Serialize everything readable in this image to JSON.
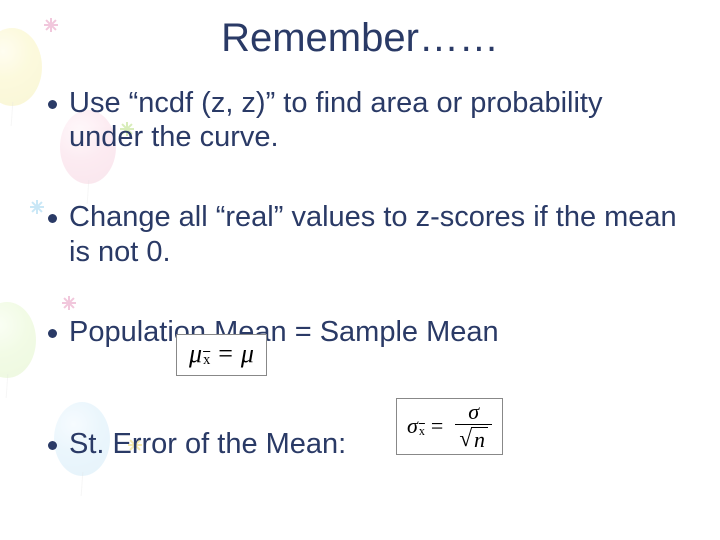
{
  "slide": {
    "title": "Remember……",
    "bullets": [
      "Use “ncdf (z, z)” to find area or probability under the curve.",
      "Change all “real” values to z-scores if the mean is not 0.",
      "Population Mean = Sample Mean",
      "St. Error of the Mean:"
    ],
    "formulas": {
      "population_mean": {
        "display": "μ_x̄ = μ",
        "lhs_symbol": "μ",
        "lhs_subscript_is_xbar": true,
        "rhs_symbol": "μ"
      },
      "std_error_mean": {
        "display": "σ_x̄ = σ / √n",
        "lhs_symbol": "σ",
        "lhs_subscript_is_xbar": true,
        "numerator": "σ",
        "denominator_sqrt_arg": "n"
      }
    }
  }
}
